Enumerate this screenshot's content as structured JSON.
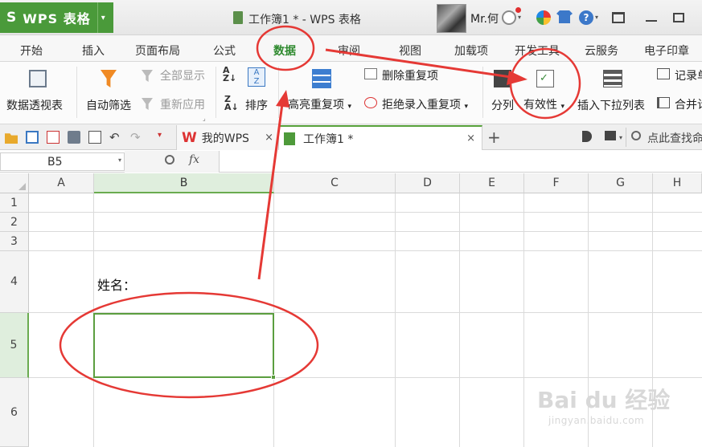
{
  "titlebar": {
    "app_logo": "S",
    "app_name": "WPS 表格",
    "window_title": "工作簿1 * - WPS 表格",
    "username": "Mr.何"
  },
  "tabs": [
    {
      "label": "开始"
    },
    {
      "label": "插入"
    },
    {
      "label": "页面布局"
    },
    {
      "label": "公式"
    },
    {
      "label": "数据",
      "active": true
    },
    {
      "label": "审阅"
    },
    {
      "label": "视图"
    },
    {
      "label": "加载项"
    },
    {
      "label": "开发工具"
    },
    {
      "label": "云服务"
    },
    {
      "label": "电子印章"
    }
  ],
  "ribbon": {
    "pivot": "数据透视表",
    "autofilter": "自动筛选",
    "show_all": "全部显示",
    "reapply": "重新应用",
    "sort": "排序",
    "highlight_dup": "高亮重复项",
    "remove_dup": "删除重复项",
    "reject_dup": "拒绝录入重复项",
    "split": "分列",
    "validity": "有效性",
    "insert_dropdown": "插入下拉列表",
    "record": "记录单",
    "merge": "合并计"
  },
  "docbar": {
    "tab_wps": "我的WPS",
    "tab_book": "工作簿1 *",
    "search": "点此查找命"
  },
  "formula_bar": {
    "name_box": "B5",
    "fx": "fx"
  },
  "grid": {
    "columns": [
      "A",
      "B",
      "C",
      "D",
      "E",
      "F",
      "G",
      "H"
    ],
    "rows": [
      "1",
      "2",
      "3",
      "4",
      "5",
      "6"
    ],
    "selected_cell": "B5",
    "cells": {
      "B4": "姓名："
    }
  },
  "watermark": {
    "brand": "Bai du 经验",
    "url": "jingyan.baidu.com"
  },
  "colors": {
    "brand_green": "#4a9a3a",
    "selection_green": "#5b9e3f",
    "annotation_red": "#e53935"
  }
}
